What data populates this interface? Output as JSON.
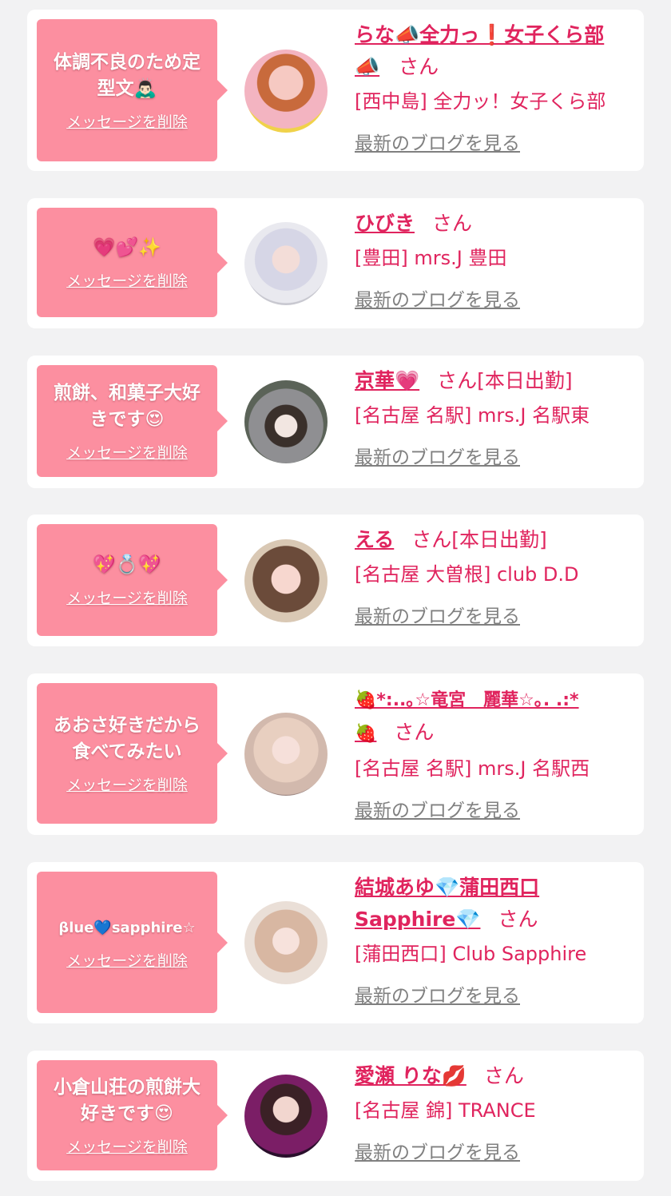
{
  "delete_label": "メッセージを削除",
  "san_label": "さん",
  "blog_label": "最新のブログを見る",
  "colors": {
    "accent": "#e0245e",
    "bubble": "#fc8fa0",
    "muted": "#808080"
  },
  "cards": [
    {
      "message": "体調不良のため定\n型文🙇🏻‍♂️",
      "name": "らな📣全力っ❗女子くら部\n📣",
      "status": "",
      "shop": "[西中島] 全力ッ！女子くら部"
    },
    {
      "message": "💗💕✨",
      "name": "ひびき",
      "status": "",
      "shop": "[豊田] mrs.J 豊田"
    },
    {
      "message": "煎餅、和菓子大好\nきです😍",
      "name": "京華💗",
      "status": "[本日出勤]",
      "shop": "[名古屋 名駅] mrs.J 名駅東"
    },
    {
      "message": "💖💍💖",
      "name": "える",
      "status": "[本日出勤]",
      "shop": "[名古屋 大曽根] club D.D"
    },
    {
      "message": "あおさ好きだから\n食べてみたい",
      "name": "🍓*:..｡☆竜宮　麗華☆｡. .:*\n🍓",
      "status": "",
      "shop": "[名古屋 名駅] mrs.J 名駅西"
    },
    {
      "message": "βlue💙sapphire☆",
      "name": "結城あゆ💎蒲田西口\nSapphire💎",
      "status": "",
      "shop": "[蒲田西口] Club Sapphire"
    },
    {
      "message": "小倉山荘の煎餅大\n好きです😍",
      "name": "愛瀬 りな💋",
      "status": "",
      "shop": "[名古屋 錦] TRANCE"
    }
  ]
}
